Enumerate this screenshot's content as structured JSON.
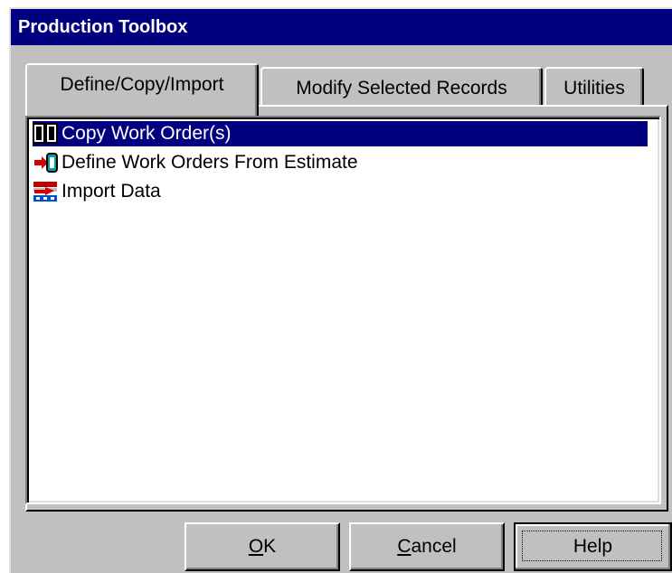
{
  "window": {
    "title": "Production Toolbox"
  },
  "tabs": [
    {
      "label": "Define/Copy/Import",
      "active": true
    },
    {
      "label": "Modify Selected Records",
      "active": false
    },
    {
      "label": "Utilities",
      "active": false
    }
  ],
  "list": {
    "items": [
      {
        "label": "Copy Work Order(s)",
        "icon": "copy-pages-icon",
        "selected": true
      },
      {
        "label": "Define Work Orders From Estimate",
        "icon": "define-from-estimate-icon",
        "selected": false
      },
      {
        "label": "Import Data",
        "icon": "import-data-icon",
        "selected": false
      }
    ]
  },
  "buttons": {
    "ok": {
      "mnemonic": "O",
      "rest": "K"
    },
    "cancel": {
      "mnemonic": "C",
      "rest": "ancel"
    },
    "help": {
      "label": "Help"
    }
  },
  "colors": {
    "titlebar": "#000080",
    "face": "#c0c0c0",
    "selection": "#000080"
  }
}
